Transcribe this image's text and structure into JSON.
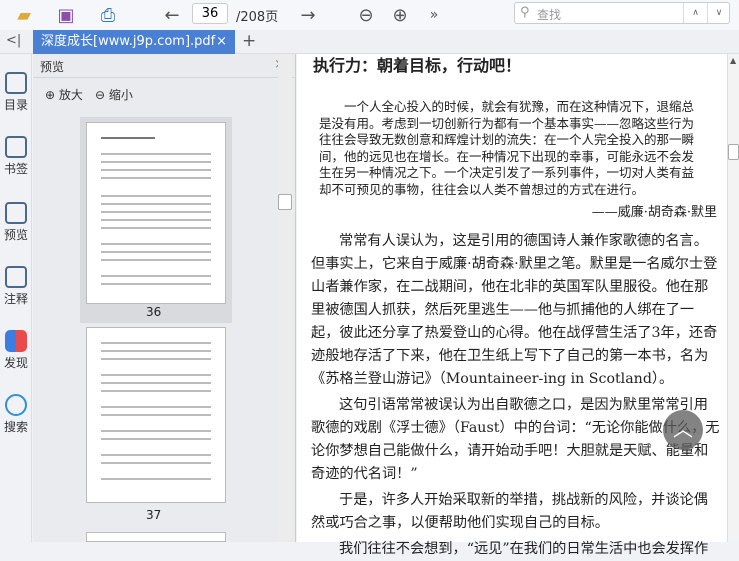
{
  "toolbar": {
    "page_current": "36",
    "page_total": "/208页",
    "search_placeholder": "查找",
    "more": "»"
  },
  "tab": {
    "title": "深度成长[www.j9p.com].pdf",
    "close": "×",
    "add": "+",
    "collapse": "<|"
  },
  "sidebar": {
    "items": [
      {
        "label": "目录"
      },
      {
        "label": "书签"
      },
      {
        "label": "预览"
      },
      {
        "label": "注释"
      },
      {
        "label": "发现"
      },
      {
        "label": "搜索"
      }
    ]
  },
  "preview": {
    "title": "预览",
    "close": "×",
    "zoom_in": "放大",
    "zoom_out": "缩小",
    "pages": [
      "36",
      "37"
    ]
  },
  "document": {
    "heading": "执行力：朝着目标，行动吧！",
    "quote": "一个人全心投入的时候，就会有犹豫，而在这种情况下，退缩总是没有用。考虑到一切创新行为都有一个基本事实——忽略这些行为往往会导致无数创意和辉煌计划的流失：在一个人完全投入的那一瞬间，他的远见也在增长。在一种情况下出现的幸事，可能永远不会发生在另一种情况之下。一个决定引发了一系列事件，一切对人类有益却不可预见的事物，往往会以人类不曾想过的方式在进行。",
    "attribution": "——威廉·胡奇森·默里",
    "paragraphs": [
      "常常有人误认为，这是引用的德国诗人兼作家歌德的名言。但事实上，它来自于威廉·胡奇森·默里之笔。默里是一名威尔士登山者兼作家，在二战期间，他在北非的英国军队里服役。他在那里被德国人抓获，然后死里逃生——他与抓捕他的人绑在了一起，彼此还分享了热爱登山的心得。他在战俘营生活了3年，还奇迹般地存活了下来，他在卫生纸上写下了自己的第一本书，名为《苏格兰登山游记》（Mountaineer-ing in Scotland）。",
      "这句引语常常被误认为出自歌德之口，是因为默里常常引用歌德的戏剧《浮士德》（Faust）中的台词：“无论你能做什么，无论你梦想自己能做什么，请开始动手吧！大胆就是天赋、能量和奇迹的代名词！”",
      "于是，许多人开始采取新的举措，挑战新的风险，并谈论偶然或巧合之事，以便帮助他们实现自己的目标。",
      "我们往往不会想到，“远见”在我们的日常生活中也会发挥作"
    ]
  }
}
